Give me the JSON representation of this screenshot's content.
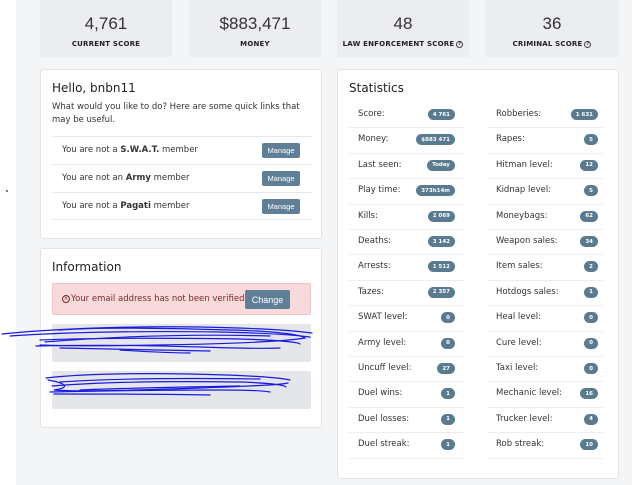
{
  "top_stats": [
    {
      "value": "4,761",
      "label": "CURRENT SCORE",
      "help": false
    },
    {
      "value": "$883,471",
      "label": "MONEY",
      "help": false
    },
    {
      "value": "48",
      "label": "LAW ENFORCEMENT SCORE",
      "help": true
    },
    {
      "value": "36",
      "label": "CRIMINAL SCORE",
      "help": true
    }
  ],
  "hello": {
    "title": "Hello, bnbn11",
    "intro": "What would you like to do? Here are some quick links that may be useful.",
    "manage_label": "Manage",
    "memberships": [
      {
        "prefix": "You are not a",
        "org": "S.W.A.T.",
        "suffix": "member"
      },
      {
        "prefix": "You are not an",
        "org": "Army",
        "suffix": "member"
      },
      {
        "prefix": "You are not a",
        "org": "Pagati",
        "suffix": "member"
      }
    ]
  },
  "information": {
    "title": "Information",
    "alert_icon": "x-circle-icon",
    "alert_text": "Your email address has not been verified.",
    "change_label": "Change"
  },
  "statistics": {
    "title": "Statistics",
    "left": [
      {
        "label": "Score:",
        "value": "4 761"
      },
      {
        "label": "Money:",
        "value": "$883 471"
      },
      {
        "label": "Last seen:",
        "value": "Today"
      },
      {
        "label": "Play time:",
        "value": "373h14m"
      },
      {
        "label": "Kills:",
        "value": "2 069"
      },
      {
        "label": "Deaths:",
        "value": "3 142"
      },
      {
        "label": "Arrests:",
        "value": "1 512"
      },
      {
        "label": "Tazes:",
        "value": "2 357"
      },
      {
        "label": "SWAT level:",
        "value": "0"
      },
      {
        "label": "Army level:",
        "value": "0"
      },
      {
        "label": "Uncuff level:",
        "value": "27"
      },
      {
        "label": "Duel wins:",
        "value": "1"
      },
      {
        "label": "Duel losses:",
        "value": "1"
      },
      {
        "label": "Duel streak:",
        "value": "1"
      }
    ],
    "right": [
      {
        "label": "Robberies:",
        "value": "1 631"
      },
      {
        "label": "Rapes:",
        "value": "5"
      },
      {
        "label": "Hitman level:",
        "value": "12"
      },
      {
        "label": "Kidnap level:",
        "value": "5"
      },
      {
        "label": "Moneybags:",
        "value": "62"
      },
      {
        "label": "Weapon sales:",
        "value": "34"
      },
      {
        "label": "Item sales:",
        "value": "2"
      },
      {
        "label": "Hotdogs sales:",
        "value": "1"
      },
      {
        "label": "Heal level:",
        "value": "0"
      },
      {
        "label": "Cure level:",
        "value": "0"
      },
      {
        "label": "Taxi level:",
        "value": "0"
      },
      {
        "label": "Mechanic level:",
        "value": "16"
      },
      {
        "label": "Trucker level:",
        "value": "4"
      },
      {
        "label": "Rob streak:",
        "value": "10"
      }
    ]
  },
  "colors": {
    "button": "#5f7f96",
    "badge": "#5a7a90",
    "alert_bg": "#f8dadc",
    "scribble": "#1a1adf"
  }
}
